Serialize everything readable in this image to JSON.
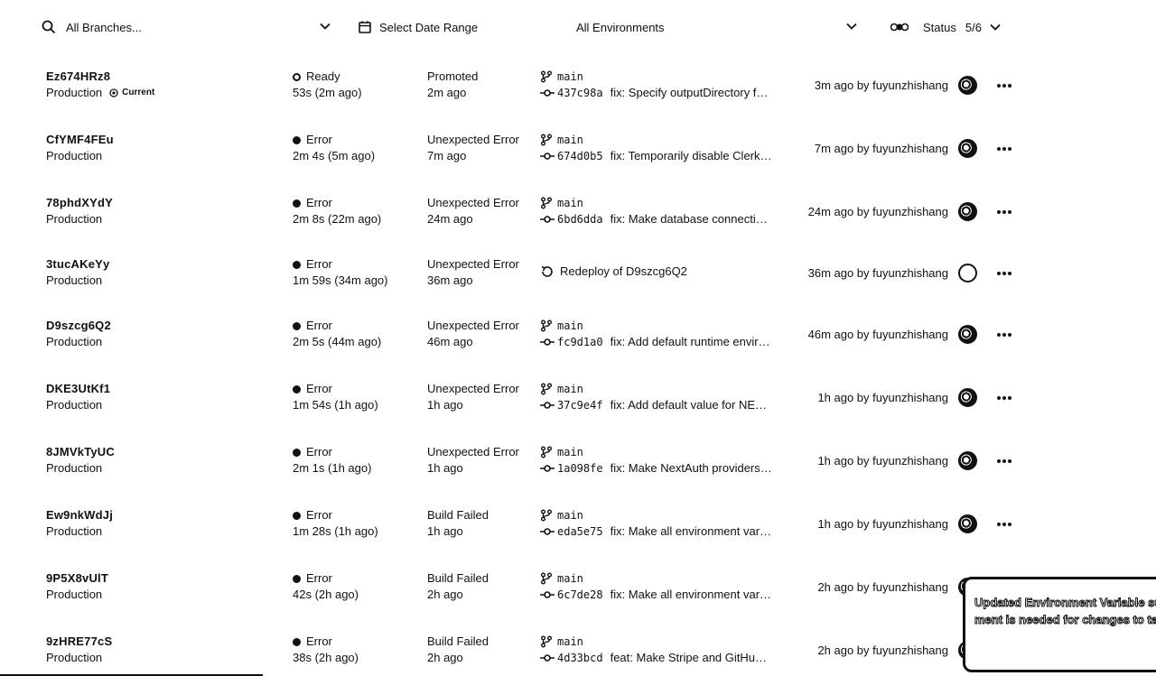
{
  "filters": {
    "branch_placeholder": "All Branches...",
    "date_label": "Select Date Range",
    "environment_label": "All Environments",
    "status_label": "Status",
    "status_count": "5/6"
  },
  "deployments": [
    {
      "id": "Ez674HRz8",
      "env": "Production",
      "current_label": "Current",
      "status": "Ready",
      "duration": "53s (2m ago)",
      "result": "Promoted",
      "result_time": "2m ago",
      "branch": "main",
      "commit": "437c98a",
      "message": "fix: Specify outputDirectory f…",
      "time_by": "3m ago by fuyunzhishang"
    },
    {
      "id": "CfYMF4FEu",
      "env": "Production",
      "status": "Error",
      "duration": "2m 4s (5m ago)",
      "result": "Unexpected Error",
      "result_time": "7m ago",
      "branch": "main",
      "commit": "674d0b5",
      "message": "fix: Temporarily disable Clerk…",
      "time_by": "7m ago by fuyunzhishang"
    },
    {
      "id": "78phdXYdY",
      "env": "Production",
      "status": "Error",
      "duration": "2m 8s (22m ago)",
      "result": "Unexpected Error",
      "result_time": "24m ago",
      "branch": "main",
      "commit": "6bd6dda",
      "message": "fix: Make database connecti…",
      "time_by": "24m ago by fuyunzhishang"
    },
    {
      "id": "3tucAKeYy",
      "env": "Production",
      "status": "Error",
      "duration": "1m 59s (34m ago)",
      "result": "Unexpected Error",
      "result_time": "36m ago",
      "redeploy": "Redeploy of D9szcg6Q2",
      "time_by": "36m ago by fuyunzhishang"
    },
    {
      "id": "D9szcg6Q2",
      "env": "Production",
      "status": "Error",
      "duration": "2m 5s (44m ago)",
      "result": "Unexpected Error",
      "result_time": "46m ago",
      "branch": "main",
      "commit": "fc9d1a0",
      "message": "fix: Add default runtime envir…",
      "time_by": "46m ago by fuyunzhishang"
    },
    {
      "id": "DKE3UtKf1",
      "env": "Production",
      "status": "Error",
      "duration": "1m 54s (1h ago)",
      "result": "Unexpected Error",
      "result_time": "1h ago",
      "branch": "main",
      "commit": "37c9e4f",
      "message": "fix: Add default value for NE…",
      "time_by": "1h ago by fuyunzhishang"
    },
    {
      "id": "8JMVkTyUC",
      "env": "Production",
      "status": "Error",
      "duration": "2m 1s (1h ago)",
      "result": "Unexpected Error",
      "result_time": "1h ago",
      "branch": "main",
      "commit": "1a098fe",
      "message": "fix: Make NextAuth providers…",
      "time_by": "1h ago by fuyunzhishang"
    },
    {
      "id": "Ew9nkWdJj",
      "env": "Production",
      "status": "Error",
      "duration": "1m 28s (1h ago)",
      "result": "Build Failed",
      "result_time": "1h ago",
      "branch": "main",
      "commit": "eda5e75",
      "message": "fix: Make all environment var…",
      "time_by": "1h ago by fuyunzhishang"
    },
    {
      "id": "9P5X8vUlT",
      "env": "Production",
      "status": "Error",
      "duration": "42s (2h ago)",
      "result": "Build Failed",
      "result_time": "2h ago",
      "branch": "main",
      "commit": "6c7de28",
      "message": "fix: Make all environment var…",
      "time_by": "2h ago by fuyunzhishang"
    },
    {
      "id": "9zHRE77cS",
      "env": "Production",
      "status": "Error",
      "duration": "38s (2h ago)",
      "result": "Build Failed",
      "result_time": "2h ago",
      "branch": "main",
      "commit": "4d33bcd",
      "message": "feat: Make Stripe and GitHub…",
      "time_by": "2h ago by fuyunzhishang"
    }
  ],
  "toast": {
    "line1": "Updated Environment Variable suc",
    "line2": "ment is needed for changes to tak"
  }
}
